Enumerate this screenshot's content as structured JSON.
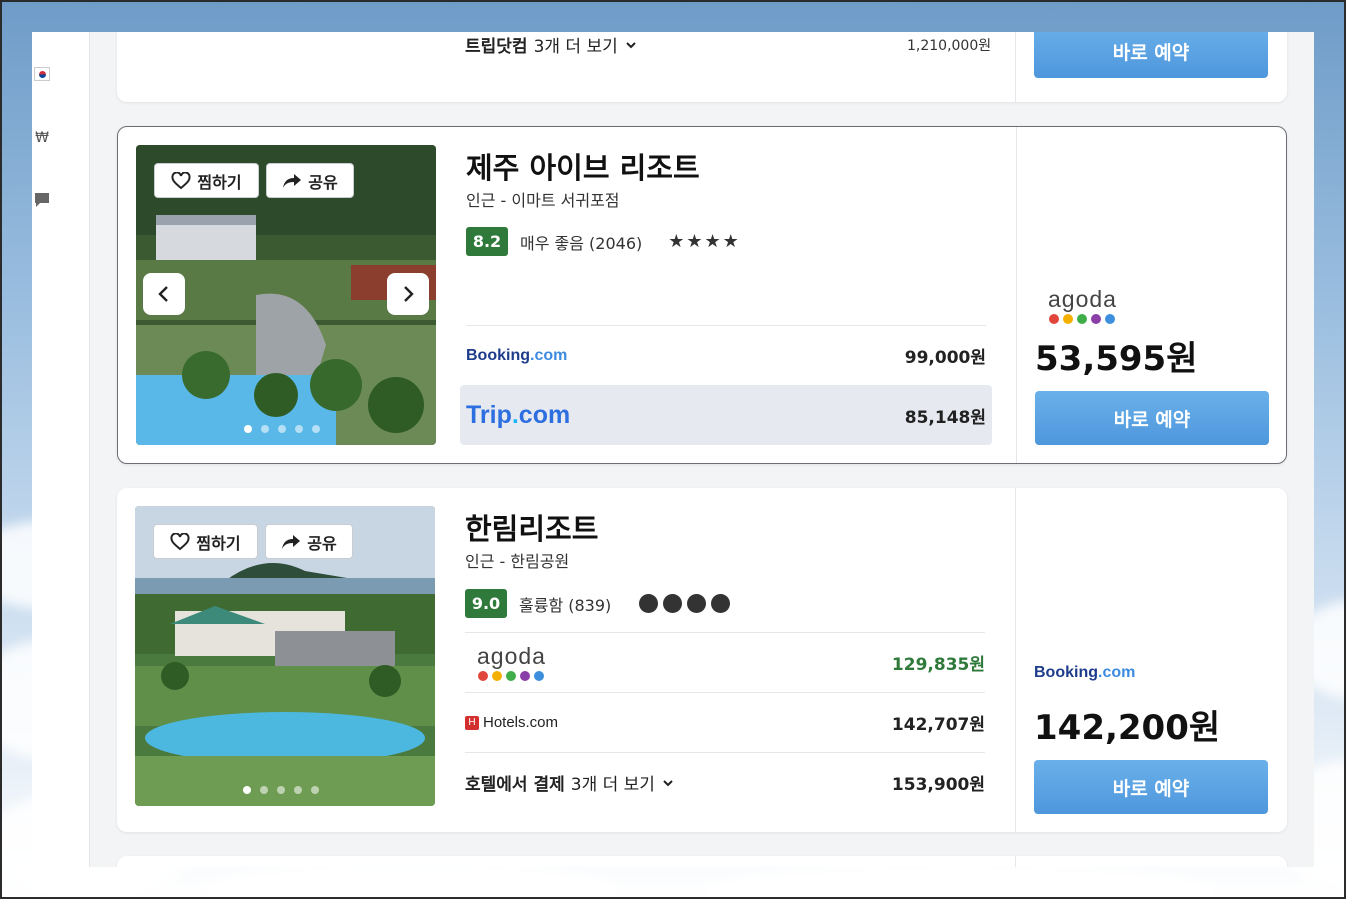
{
  "sidebar": {
    "icons": [
      "korea-flag-icon",
      "won-icon",
      "feedback-icon"
    ],
    "won_symbol": "₩"
  },
  "top_card": {
    "more_provider": "트립닷컴",
    "more_label": "3개 더 보기",
    "more_price": "1,210,000원",
    "book_label": "바로 예약"
  },
  "hotels": [
    {
      "name": "제주 아이브 리조트",
      "nearby": "인근 - 이마트 서귀포점",
      "score": "8.2",
      "review_text": "매우 좋음 (2046)",
      "stars": "★★★★",
      "fav_label": "찜하기",
      "share_label": "공유",
      "offers": [
        {
          "provider": "Booking.com",
          "price": "99,000원"
        },
        {
          "provider": "Trip.com",
          "price": "85,148원"
        }
      ],
      "best_provider": "agoda",
      "best_price": "53,595원",
      "book_label": "바로 예약"
    },
    {
      "name": "한림리조트",
      "nearby": "인근 - 한림공원",
      "score": "9.0",
      "review_text": "훌륭함 (839)",
      "fav_label": "찜하기",
      "share_label": "공유",
      "offers": [
        {
          "provider": "agoda",
          "price": "129,835원"
        },
        {
          "provider": "Hotels.com",
          "price": "142,707원"
        },
        {
          "provider": "호텔에서 결제",
          "more": "3개 더 보기",
          "price": "153,900원"
        }
      ],
      "best_provider": "Booking.com",
      "best_price": "142,200원",
      "book_label": "바로 예약"
    }
  ],
  "colors": {
    "accent_blue": "#4e97dc",
    "score_green": "#2f7a3b",
    "agoda_dots": [
      "#e0463b",
      "#f4b000",
      "#3fae49",
      "#8a3fa8",
      "#3c8fdc"
    ]
  }
}
